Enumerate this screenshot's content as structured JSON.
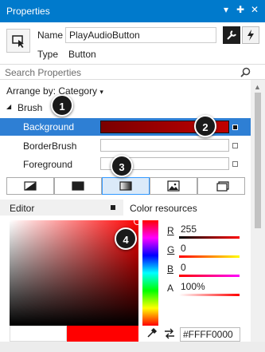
{
  "window": {
    "title": "Properties"
  },
  "title_controls": {
    "dropdown": "▾",
    "pin": "✚",
    "close": "✕"
  },
  "header": {
    "name_label": "Name",
    "name_value": "PlayAudioButton",
    "type_label": "Type",
    "type_value": "Button"
  },
  "search": {
    "placeholder": "Search Properties"
  },
  "arrange": {
    "label": "Arrange by: Category",
    "caret": "▾"
  },
  "brush": {
    "group_label": "Brush",
    "rows": [
      {
        "label": "Background"
      },
      {
        "label": "BorderBrush"
      },
      {
        "label": "Foreground"
      }
    ]
  },
  "editor": {
    "label": "Editor",
    "resources_label": "Color resources"
  },
  "channels": [
    {
      "letter": "R",
      "value": "255"
    },
    {
      "letter": "G",
      "value": "0"
    },
    {
      "letter": "B",
      "value": "0"
    },
    {
      "letter": "A",
      "value": "100%"
    }
  ],
  "hex": {
    "value": "#FFFF0000"
  },
  "callouts": [
    "1",
    "2",
    "3",
    "4"
  ],
  "colors": {
    "accent": "#007acc",
    "selected_row": "#2e7fd4",
    "background_brush": "#8b0000",
    "current_color": "#ff0000"
  },
  "icons": [
    "selection-icon",
    "wrench-icon",
    "lightning-icon",
    "search-icon",
    "no-brush-icon",
    "solid-brush-icon",
    "gradient-brush-icon",
    "image-brush-icon",
    "resource-brush-icon",
    "eyedropper-icon",
    "swap-icon"
  ]
}
